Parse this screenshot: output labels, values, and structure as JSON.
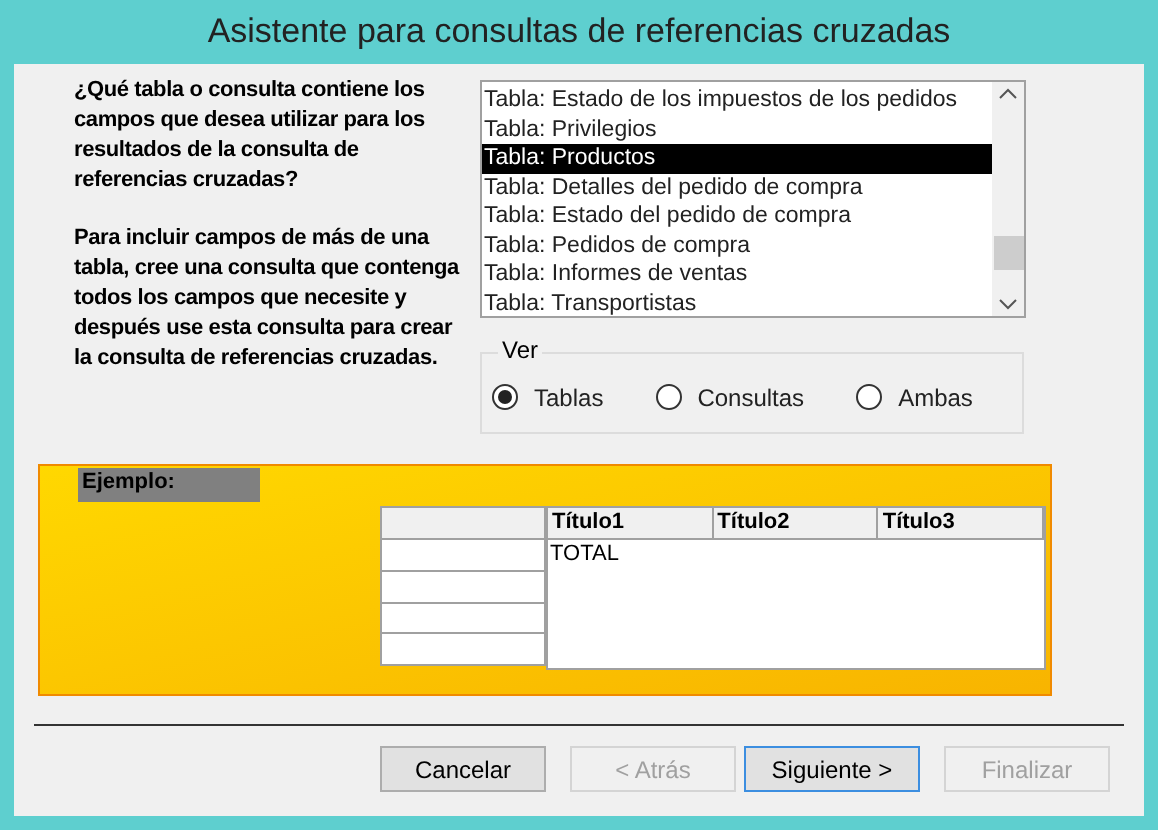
{
  "window": {
    "title": "Asistente para consultas de referencias cruzadas"
  },
  "question": "¿Qué tabla o consulta contiene los campos que desea utilizar para los resultados de la consulta de referencias cruzadas?",
  "hint": "Para incluir campos de más de una tabla, cree una consulta que contenga todos los campos que necesite y después use esta consulta para crear la consulta de referencias cruzadas.",
  "list": {
    "items": [
      {
        "label": "Tabla: Estado de los impuestos de los pedidos",
        "selected": false
      },
      {
        "label": "Tabla: Privilegios",
        "selected": false
      },
      {
        "label": "Tabla: Productos",
        "selected": true
      },
      {
        "label": "Tabla: Detalles del pedido de compra",
        "selected": false
      },
      {
        "label": "Tabla: Estado del pedido de compra",
        "selected": false
      },
      {
        "label": "Tabla: Pedidos de compra",
        "selected": false
      },
      {
        "label": "Tabla: Informes de ventas",
        "selected": false
      },
      {
        "label": "Tabla: Transportistas",
        "selected": false
      }
    ]
  },
  "view": {
    "legend": "Ver",
    "options": [
      {
        "label": "Tablas",
        "selected": true
      },
      {
        "label": "Consultas",
        "selected": false
      },
      {
        "label": "Ambas",
        "selected": false
      }
    ]
  },
  "example": {
    "label": "Ejemplo:",
    "columns": [
      "Título1",
      "Título2",
      "Título3"
    ],
    "cell": "TOTAL"
  },
  "buttons": [
    {
      "label": "Cancelar",
      "disabled": false,
      "default": false
    },
    {
      "label": "< Atrás",
      "disabled": true,
      "default": false
    },
    {
      "label": "Siguiente >",
      "disabled": false,
      "default": true
    },
    {
      "label": "Finalizar",
      "disabled": true,
      "default": false
    }
  ]
}
